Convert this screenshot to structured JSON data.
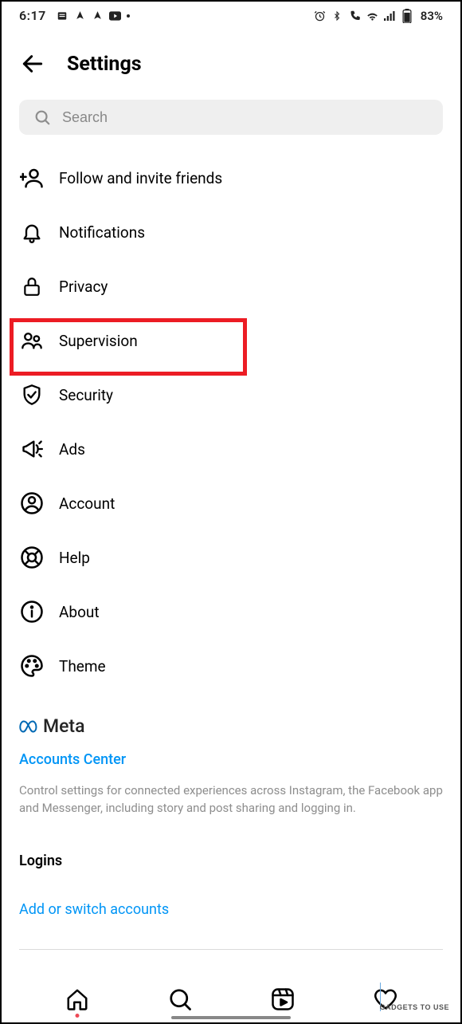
{
  "status": {
    "time": "6:17",
    "battery": "83%"
  },
  "header": {
    "title": "Settings"
  },
  "search": {
    "placeholder": "Search"
  },
  "items": {
    "follow": "Follow and invite friends",
    "notifications": "Notifications",
    "privacy": "Privacy",
    "supervision": "Supervision",
    "security": "Security",
    "ads": "Ads",
    "account": "Account",
    "help": "Help",
    "about": "About",
    "theme": "Theme"
  },
  "meta": {
    "brand": "Meta",
    "accounts_center": "Accounts Center",
    "description": "Control settings for connected experiences across Instagram, the Facebook app and Messenger, including story and post sharing and logging in."
  },
  "logins": {
    "heading": "Logins",
    "add_switch": "Add or switch accounts"
  },
  "watermark": "GADGETS TO USE"
}
